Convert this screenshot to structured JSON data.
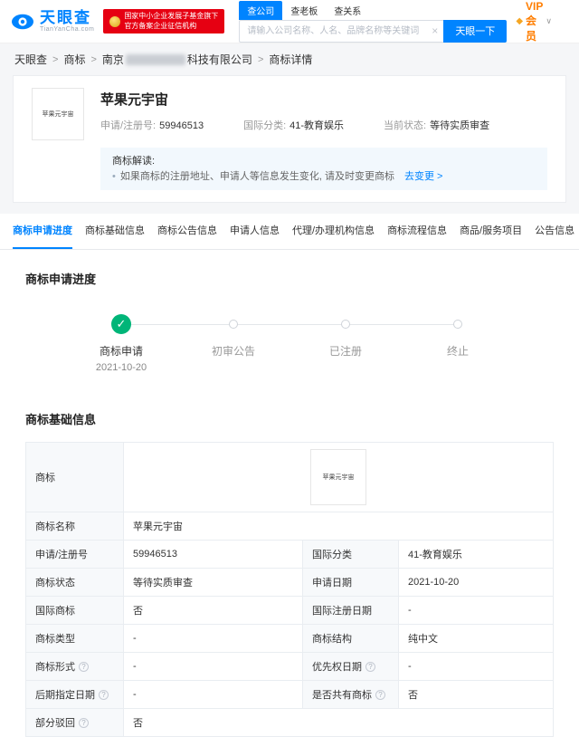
{
  "colors": {
    "accent_blue": "#0084ff",
    "badge_red": "#e60012",
    "vip_orange": "#ff7e00",
    "success_green": "#00b578",
    "label_cell_bg": "#f7f9fb",
    "notice_bg": "#f2f8fd"
  },
  "icons": {
    "info": "?",
    "clear": "×",
    "caret": "∨",
    "bullet": "•",
    "check": "✓",
    "vip": "◆"
  },
  "header": {
    "logo_cn": "天眼查",
    "logo_en": "TianYanCha.com",
    "badge_line1": "国家中小企业发展子基金旗下",
    "badge_line2": "官方备案企业征信机构",
    "search_tabs": [
      "查公司",
      "查老板",
      "查关系"
    ],
    "search_placeholder": "请输入公司名称、人名、品牌名称等关键词",
    "search_button": "天眼一下",
    "vip_label": "VIP会员"
  },
  "breadcrumb": {
    "separator": ">",
    "items": [
      "天眼查",
      "商标"
    ],
    "company_prefix": "南京",
    "company_suffix": "科技有限公司",
    "current": "商标详情"
  },
  "summary": {
    "image_text": "苹果元宇宙",
    "title": "苹果元宇宙",
    "fields": [
      {
        "label": "申请/注册号:",
        "value": "59946513"
      },
      {
        "label": "国际分类:",
        "value": "41-教育娱乐"
      },
      {
        "label": "当前状态:",
        "value": "等待实质审查"
      }
    ],
    "notice": {
      "title": "商标解读:",
      "text": "如果商标的注册地址、申请人等信息发生变化, 请及时变更商标",
      "link": "去变更 >"
    }
  },
  "tabs": [
    {
      "label": "商标申请进度",
      "active": true
    },
    {
      "label": "商标基础信息",
      "active": false
    },
    {
      "label": "商标公告信息",
      "active": false
    },
    {
      "label": "申请人信息",
      "active": false
    },
    {
      "label": "代理/办理机构信息",
      "active": false
    },
    {
      "label": "商标流程信息",
      "active": false
    },
    {
      "label": "商品/服务项目",
      "active": false
    },
    {
      "label": "公告信息",
      "active": false
    }
  ],
  "progress": {
    "title": "商标申请进度",
    "steps": [
      {
        "label": "商标申请",
        "date": "2021-10-20",
        "state": "done"
      },
      {
        "label": "初审公告",
        "state": "pending"
      },
      {
        "label": "已注册",
        "state": "pending"
      },
      {
        "label": "终止",
        "state": "pending"
      }
    ]
  },
  "basic": {
    "title": "商标基础信息",
    "trademark_label": "商标",
    "image_text": "苹果元宇宙",
    "rows": [
      {
        "l1": "商标名称",
        "v1": "苹果元宇宙"
      },
      {
        "l1": "申请/注册号",
        "v1": "59946513",
        "l2": "国际分类",
        "v2": "41-教育娱乐"
      },
      {
        "l1": "商标状态",
        "v1": "等待实质审查",
        "l2": "申请日期",
        "v2": "2021-10-20"
      },
      {
        "l1": "国际商标",
        "v1": "否",
        "l2": "国际注册日期",
        "v2": "-"
      },
      {
        "l1": "商标类型",
        "v1": "-",
        "l2": "商标结构",
        "v2": "纯中文"
      },
      {
        "l1": "商标形式",
        "v1": "-",
        "l2": "优先权日期",
        "v2": "-"
      },
      {
        "l1": "后期指定日期",
        "v1": "-",
        "l2": "是否共有商标",
        "v2": "否"
      },
      {
        "l1": "部分驳回",
        "v1": "否"
      }
    ]
  }
}
